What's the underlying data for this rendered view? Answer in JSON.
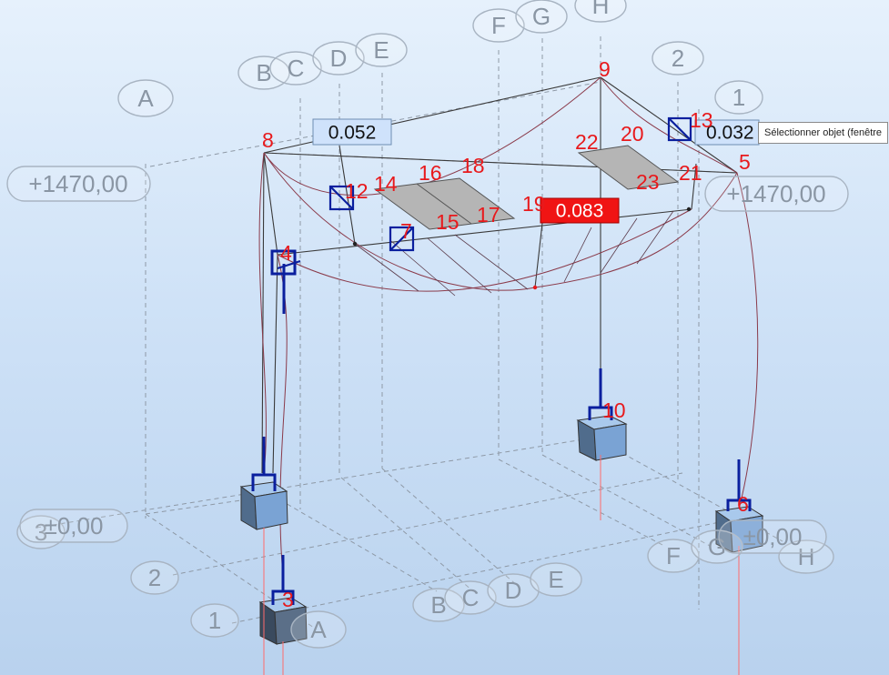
{
  "viewport": {
    "grid_letters": [
      "A",
      "B",
      "C",
      "D",
      "E",
      "F",
      "G",
      "H"
    ],
    "grid_numbers": [
      "1",
      "2",
      "3"
    ],
    "levels": [
      "+1470,00",
      "±0,00"
    ],
    "node_labels": [
      "3",
      "4",
      "5",
      "6",
      "7",
      "8",
      "9",
      "10",
      "12",
      "13",
      "14",
      "15",
      "16",
      "17",
      "18",
      "19",
      "20",
      "21",
      "22",
      "23"
    ],
    "result_labels": {
      "label_1": "0.052",
      "label_2": "0.032",
      "label_3_max": "0.083"
    }
  },
  "tooltip": "Sélectionner objet (fenêtre"
}
